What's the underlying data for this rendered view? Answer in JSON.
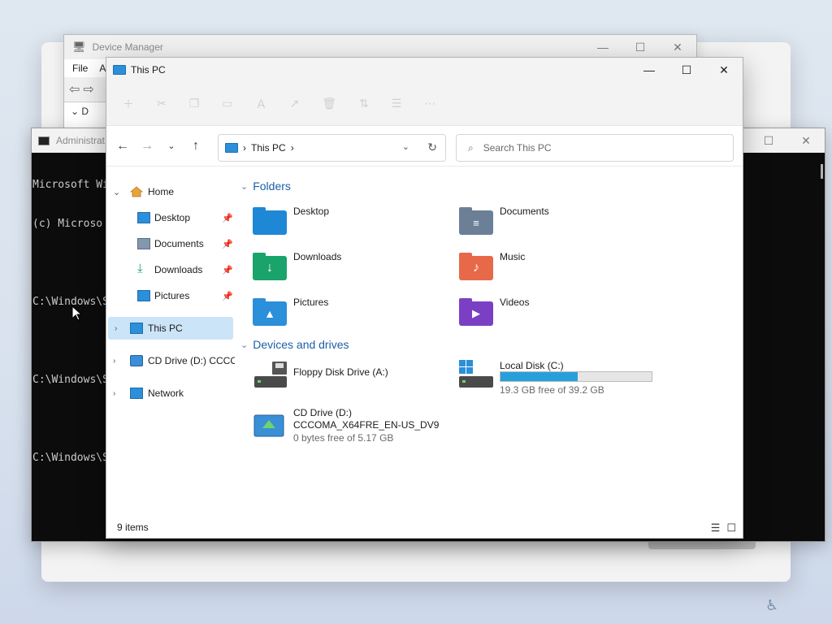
{
  "devmgr": {
    "title": "Device Manager",
    "menu": [
      "File",
      "A"
    ],
    "tree_label": "D"
  },
  "cmd": {
    "title": "Administrat",
    "lines": [
      "Microsoft Wi",
      "(c) Microso",
      "",
      "C:\\Windows\\S",
      "",
      "C:\\Windows\\S",
      "",
      "C:\\Windows\\S"
    ]
  },
  "explorer": {
    "title": "This PC",
    "address": {
      "crumb": "This PC",
      "sep": "›"
    },
    "search_placeholder": "Search This PC",
    "sidebar": [
      {
        "label": "Home",
        "icon": "home-icon",
        "expanded": true
      },
      {
        "label": "Desktop",
        "icon": "desktop-icon",
        "pinned": true
      },
      {
        "label": "Documents",
        "icon": "documents-icon",
        "pinned": true
      },
      {
        "label": "Downloads",
        "icon": "downloads-icon",
        "pinned": true
      },
      {
        "label": "Pictures",
        "icon": "pictures-icon",
        "pinned": true
      },
      {
        "label": "This PC",
        "icon": "this-pc-icon",
        "selected": true
      },
      {
        "label": "CD Drive (D:) CCCO",
        "icon": "cd-drive-icon"
      },
      {
        "label": "Network",
        "icon": "network-icon"
      }
    ],
    "sections": {
      "folders": "Folders",
      "drives": "Devices and drives"
    },
    "folders": [
      {
        "name": "Desktop",
        "color": "#1e88d6"
      },
      {
        "name": "Documents",
        "color": "#6b7f97"
      },
      {
        "name": "Downloads",
        "color": "#1aa36a"
      },
      {
        "name": "Music",
        "color": "#e8684a"
      },
      {
        "name": "Pictures",
        "color": "#2b8fd9"
      },
      {
        "name": "Videos",
        "color": "#7b3fc4"
      }
    ],
    "drives": [
      {
        "name": "Floppy Disk Drive (A:)"
      },
      {
        "name": "Local Disk (C:)",
        "free": "19.3 GB free of 39.2 GB",
        "used_fraction": 0.51
      },
      {
        "name": "CD Drive (D:)",
        "name2": "CCCOMA_X64FRE_EN-US_DV9",
        "free": "0 bytes free of 5.17 GB"
      }
    ],
    "status": "9 items"
  },
  "colors": {
    "accent": "#1b5fa8",
    "selected": "#cce4f7",
    "bar_fill": "#26a0da"
  }
}
